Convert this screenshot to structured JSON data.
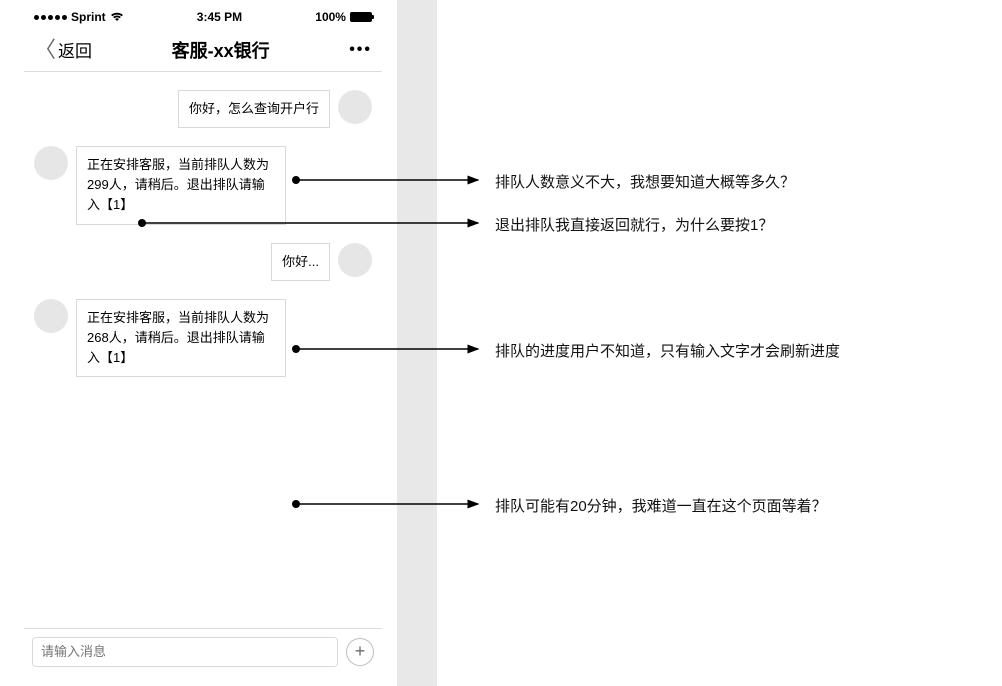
{
  "status": {
    "carrier": "Sprint",
    "wifi_icon": "wifi",
    "time": "3:45 PM",
    "battery_pct": "100%"
  },
  "nav": {
    "back_label": "返回",
    "title": "客服-xx银行",
    "more": "•••"
  },
  "chat": {
    "msg1": "你好，怎么查询开户行",
    "msg2": "正在安排客服，当前排队人数为299人，请稍后。退出排队请输入【1】",
    "msg3": "你好...",
    "msg4": "正在安排客服，当前排队人数为268人，请稍后。退出排队请输入【1】"
  },
  "input": {
    "placeholder": "请输入消息",
    "plus": "+"
  },
  "annotations": {
    "a1": "排队人数意义不大，我想要知道大概等多久？",
    "a2": "退出排队我直接返回就行，为什么要按1？",
    "a3": "排队的进度用户不知道，只有输入文字才会刷新进度",
    "a4": "排队可能有20分钟，我难道一直在这个页面等着？"
  }
}
